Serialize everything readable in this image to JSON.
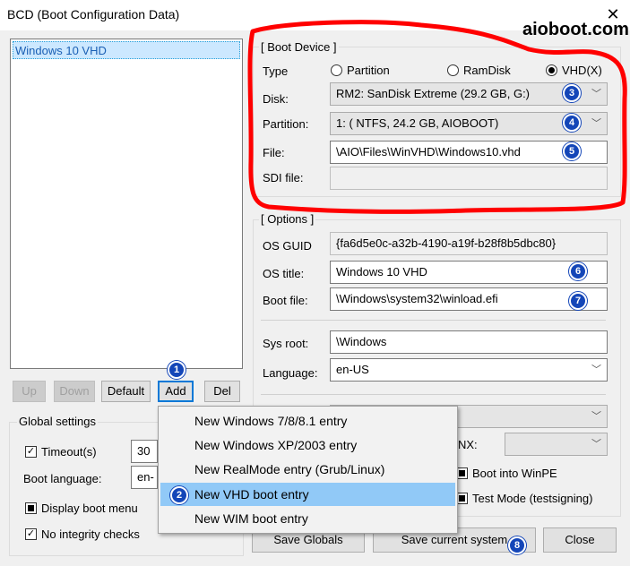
{
  "window": {
    "title": "BCD (Boot Configuration Data)",
    "close_glyph": "✕"
  },
  "watermark": "aioboot.com",
  "entries": [
    "Windows 10 VHD"
  ],
  "list_buttons": {
    "up": "Up",
    "down": "Down",
    "default": "Default",
    "add": "Add",
    "del": "Del"
  },
  "boot_device": {
    "group_label": "[ Boot Device ]",
    "type_label": "Type",
    "type_options": [
      "Partition",
      "RamDisk",
      "VHD(X)"
    ],
    "type_selected": "VHD(X)",
    "disk_label": "Disk:",
    "disk_value": "RM2: SanDisk Extreme (29.2 GB, G:)",
    "partition_label": "Partition:",
    "partition_value": "1: ( NTFS,  24.2 GB, AIOBOOT)",
    "file_label": "File:",
    "file_value": "\\AIO\\Files\\WinVHD\\Windows10.vhd",
    "sdi_label": "SDI file:",
    "sdi_value": ""
  },
  "options": {
    "group_label": "[ Options ]",
    "guid_label": "OS GUID",
    "guid_value": "{fa6d5e0c-a32b-4190-a19f-b28f8b5dbc80}",
    "title_label": "OS title:",
    "title_value": "Windows 10 VHD",
    "bootfile_label": "Boot file:",
    "bootfile_value": "\\Windows\\system32\\winload.efi",
    "sysroot_label": "Sys root:",
    "sysroot_value": "\\Windows",
    "language_label": "Language:",
    "language_value": "en-US",
    "nx_partial": "NX:",
    "winpe_label": "Boot into WinPE",
    "testmode_label": "Test Mode (testsigning)"
  },
  "global": {
    "group_label": "Global settings",
    "timeout_label": "Timeout(s)",
    "timeout_value": "30",
    "bootlang_label": "Boot language:",
    "bootlang_value": "en-",
    "display_menu_label": "Display boot menu",
    "no_integrity_label": "No integrity checks"
  },
  "bottom_buttons": {
    "save_globals": "Save Globals",
    "save_current": "Save current system",
    "close": "Close"
  },
  "add_menu": {
    "items": [
      "New Windows 7/8/8.1 entry",
      "New Windows XP/2003 entry",
      "New RealMode entry (Grub/Linux)",
      "New VHD boot entry",
      "New WIM boot entry"
    ],
    "highlighted": "New VHD boot entry"
  },
  "badges": [
    "1",
    "2",
    "3",
    "4",
    "5",
    "6",
    "7",
    "8"
  ],
  "colors": {
    "highlight_outline": "#ff0000",
    "badge": "#1446b8",
    "menu_highlight": "#91c9f7"
  }
}
